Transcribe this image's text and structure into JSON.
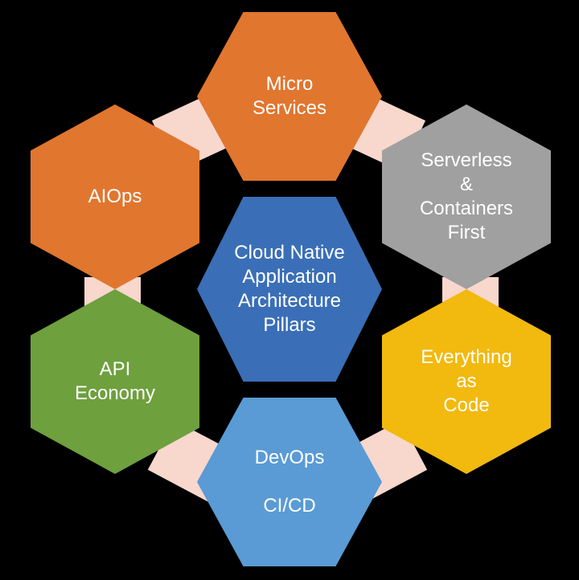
{
  "diagram": {
    "center": {
      "label": "Cloud Native\nApplication\nArchitecture\nPillars",
      "color": "#3a6fb7"
    },
    "nodes": {
      "micro": {
        "label": "Micro\nServices",
        "color": "#e1762f"
      },
      "serverless": {
        "label": "Serverless\n&\nContainers\nFirst",
        "color": "#a0a0a0"
      },
      "eac": {
        "label": "Everything\nas\nCode",
        "color": "#f2b90e"
      },
      "devops": {
        "label": "DevOps\n\nCI/CD",
        "color": "#5a9bd5"
      },
      "api": {
        "label": "API\nEconomy",
        "color": "#6ea03e"
      },
      "aiops": {
        "label": "AIOps",
        "color": "#e1762f"
      }
    },
    "connector_color": "#f8d7cd"
  }
}
